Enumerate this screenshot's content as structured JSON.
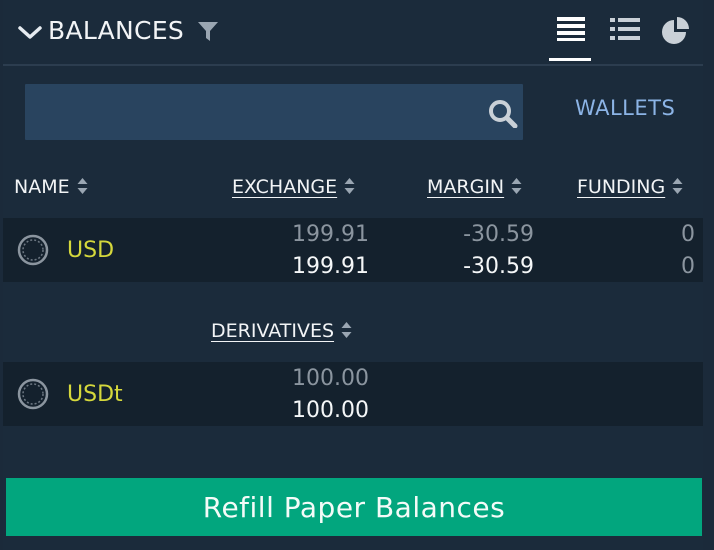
{
  "header": {
    "title": "BALANCES",
    "icons": {
      "collapse": "chevron-down-icon",
      "filter": "filter-icon",
      "views": [
        "list-view-icon",
        "compact-list-icon",
        "pie-chart-icon"
      ]
    }
  },
  "search": {
    "placeholder": "",
    "value": ""
  },
  "wallets_link": "WALLETS",
  "columns": {
    "name": "NAME",
    "exchange": "EXCHANGE",
    "margin": "MARGIN",
    "funding": "FUNDING"
  },
  "rows": [
    {
      "currency": "USD",
      "exchange_total": "199.91",
      "exchange_available": "199.91",
      "margin_total": "-30.59",
      "margin_available": "-30.59",
      "funding_total": "0",
      "funding_available": "0"
    }
  ],
  "derivatives": {
    "header": "DERIVATIVES",
    "rows": [
      {
        "currency": "USDt",
        "total": "100.00",
        "available": "100.00"
      }
    ]
  },
  "refill_button": "Refill Paper Balances",
  "colors": {
    "accent_green": "#02a67e",
    "currency_yellow": "#d5d83c",
    "link_blue": "#8cb4e6",
    "panel_bg": "#1b2b3b"
  }
}
